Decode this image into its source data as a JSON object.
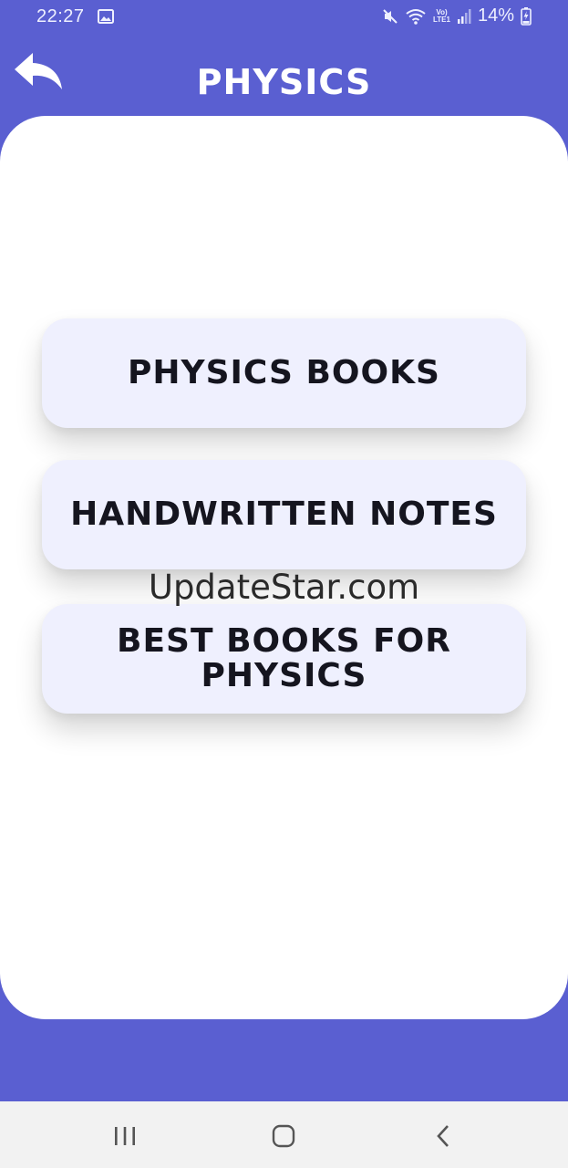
{
  "status_bar": {
    "time": "22:27",
    "battery_percent": "14%",
    "lte_top": "Vo)",
    "lte_bottom": "LTE1",
    "icons": [
      "gallery-icon",
      "mute-icon",
      "wifi-icon",
      "lte-icon",
      "signal-icon",
      "battery-charging-icon"
    ]
  },
  "header": {
    "title": "PHYSICS",
    "back_icon": "reply-arrow-icon"
  },
  "menu": {
    "items": [
      {
        "label": "PHYSICS BOOKS"
      },
      {
        "label": "HANDWRITTEN NOTES"
      },
      {
        "label": "BEST BOOKS FOR PHYSICS"
      }
    ]
  },
  "watermark": "UpdateStar.com",
  "nav_bar": {
    "icons": [
      "recent-apps-icon",
      "home-icon",
      "back-icon"
    ]
  },
  "colors": {
    "primary": "#5a5fd1",
    "card": "#ffffff",
    "button": "#eff0fe",
    "text": "#15151f"
  }
}
